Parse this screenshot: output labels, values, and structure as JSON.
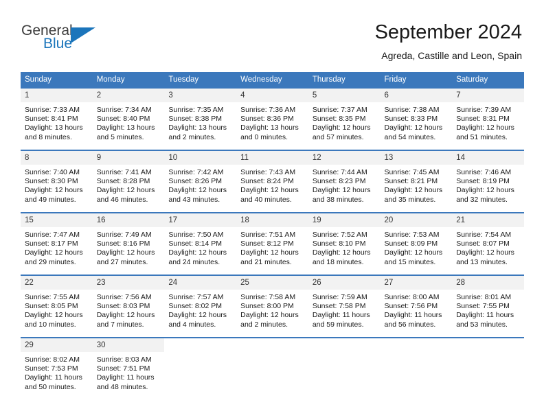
{
  "brand": {
    "line1": "General",
    "line2": "Blue",
    "accent_color": "#1b75bb"
  },
  "header": {
    "title": "September 2024",
    "subtitle": "Agreda, Castille and Leon, Spain"
  },
  "theme": {
    "header_blue": "#3b78bc",
    "daynum_bg": "#f2f2f2",
    "text": "#1a1a1a"
  },
  "weekdays": [
    "Sunday",
    "Monday",
    "Tuesday",
    "Wednesday",
    "Thursday",
    "Friday",
    "Saturday"
  ],
  "weeks": [
    [
      {
        "day": "1",
        "sunrise": "Sunrise: 7:33 AM",
        "sunset": "Sunset: 8:41 PM",
        "daylight1": "Daylight: 13 hours",
        "daylight2": "and 8 minutes."
      },
      {
        "day": "2",
        "sunrise": "Sunrise: 7:34 AM",
        "sunset": "Sunset: 8:40 PM",
        "daylight1": "Daylight: 13 hours",
        "daylight2": "and 5 minutes."
      },
      {
        "day": "3",
        "sunrise": "Sunrise: 7:35 AM",
        "sunset": "Sunset: 8:38 PM",
        "daylight1": "Daylight: 13 hours",
        "daylight2": "and 2 minutes."
      },
      {
        "day": "4",
        "sunrise": "Sunrise: 7:36 AM",
        "sunset": "Sunset: 8:36 PM",
        "daylight1": "Daylight: 13 hours",
        "daylight2": "and 0 minutes."
      },
      {
        "day": "5",
        "sunrise": "Sunrise: 7:37 AM",
        "sunset": "Sunset: 8:35 PM",
        "daylight1": "Daylight: 12 hours",
        "daylight2": "and 57 minutes."
      },
      {
        "day": "6",
        "sunrise": "Sunrise: 7:38 AM",
        "sunset": "Sunset: 8:33 PM",
        "daylight1": "Daylight: 12 hours",
        "daylight2": "and 54 minutes."
      },
      {
        "day": "7",
        "sunrise": "Sunrise: 7:39 AM",
        "sunset": "Sunset: 8:31 PM",
        "daylight1": "Daylight: 12 hours",
        "daylight2": "and 51 minutes."
      }
    ],
    [
      {
        "day": "8",
        "sunrise": "Sunrise: 7:40 AM",
        "sunset": "Sunset: 8:30 PM",
        "daylight1": "Daylight: 12 hours",
        "daylight2": "and 49 minutes."
      },
      {
        "day": "9",
        "sunrise": "Sunrise: 7:41 AM",
        "sunset": "Sunset: 8:28 PM",
        "daylight1": "Daylight: 12 hours",
        "daylight2": "and 46 minutes."
      },
      {
        "day": "10",
        "sunrise": "Sunrise: 7:42 AM",
        "sunset": "Sunset: 8:26 PM",
        "daylight1": "Daylight: 12 hours",
        "daylight2": "and 43 minutes."
      },
      {
        "day": "11",
        "sunrise": "Sunrise: 7:43 AM",
        "sunset": "Sunset: 8:24 PM",
        "daylight1": "Daylight: 12 hours",
        "daylight2": "and 40 minutes."
      },
      {
        "day": "12",
        "sunrise": "Sunrise: 7:44 AM",
        "sunset": "Sunset: 8:23 PM",
        "daylight1": "Daylight: 12 hours",
        "daylight2": "and 38 minutes."
      },
      {
        "day": "13",
        "sunrise": "Sunrise: 7:45 AM",
        "sunset": "Sunset: 8:21 PM",
        "daylight1": "Daylight: 12 hours",
        "daylight2": "and 35 minutes."
      },
      {
        "day": "14",
        "sunrise": "Sunrise: 7:46 AM",
        "sunset": "Sunset: 8:19 PM",
        "daylight1": "Daylight: 12 hours",
        "daylight2": "and 32 minutes."
      }
    ],
    [
      {
        "day": "15",
        "sunrise": "Sunrise: 7:47 AM",
        "sunset": "Sunset: 8:17 PM",
        "daylight1": "Daylight: 12 hours",
        "daylight2": "and 29 minutes."
      },
      {
        "day": "16",
        "sunrise": "Sunrise: 7:49 AM",
        "sunset": "Sunset: 8:16 PM",
        "daylight1": "Daylight: 12 hours",
        "daylight2": "and 27 minutes."
      },
      {
        "day": "17",
        "sunrise": "Sunrise: 7:50 AM",
        "sunset": "Sunset: 8:14 PM",
        "daylight1": "Daylight: 12 hours",
        "daylight2": "and 24 minutes."
      },
      {
        "day": "18",
        "sunrise": "Sunrise: 7:51 AM",
        "sunset": "Sunset: 8:12 PM",
        "daylight1": "Daylight: 12 hours",
        "daylight2": "and 21 minutes."
      },
      {
        "day": "19",
        "sunrise": "Sunrise: 7:52 AM",
        "sunset": "Sunset: 8:10 PM",
        "daylight1": "Daylight: 12 hours",
        "daylight2": "and 18 minutes."
      },
      {
        "day": "20",
        "sunrise": "Sunrise: 7:53 AM",
        "sunset": "Sunset: 8:09 PM",
        "daylight1": "Daylight: 12 hours",
        "daylight2": "and 15 minutes."
      },
      {
        "day": "21",
        "sunrise": "Sunrise: 7:54 AM",
        "sunset": "Sunset: 8:07 PM",
        "daylight1": "Daylight: 12 hours",
        "daylight2": "and 13 minutes."
      }
    ],
    [
      {
        "day": "22",
        "sunrise": "Sunrise: 7:55 AM",
        "sunset": "Sunset: 8:05 PM",
        "daylight1": "Daylight: 12 hours",
        "daylight2": "and 10 minutes."
      },
      {
        "day": "23",
        "sunrise": "Sunrise: 7:56 AM",
        "sunset": "Sunset: 8:03 PM",
        "daylight1": "Daylight: 12 hours",
        "daylight2": "and 7 minutes."
      },
      {
        "day": "24",
        "sunrise": "Sunrise: 7:57 AM",
        "sunset": "Sunset: 8:02 PM",
        "daylight1": "Daylight: 12 hours",
        "daylight2": "and 4 minutes."
      },
      {
        "day": "25",
        "sunrise": "Sunrise: 7:58 AM",
        "sunset": "Sunset: 8:00 PM",
        "daylight1": "Daylight: 12 hours",
        "daylight2": "and 2 minutes."
      },
      {
        "day": "26",
        "sunrise": "Sunrise: 7:59 AM",
        "sunset": "Sunset: 7:58 PM",
        "daylight1": "Daylight: 11 hours",
        "daylight2": "and 59 minutes."
      },
      {
        "day": "27",
        "sunrise": "Sunrise: 8:00 AM",
        "sunset": "Sunset: 7:56 PM",
        "daylight1": "Daylight: 11 hours",
        "daylight2": "and 56 minutes."
      },
      {
        "day": "28",
        "sunrise": "Sunrise: 8:01 AM",
        "sunset": "Sunset: 7:55 PM",
        "daylight1": "Daylight: 11 hours",
        "daylight2": "and 53 minutes."
      }
    ],
    [
      {
        "day": "29",
        "sunrise": "Sunrise: 8:02 AM",
        "sunset": "Sunset: 7:53 PM",
        "daylight1": "Daylight: 11 hours",
        "daylight2": "and 50 minutes."
      },
      {
        "day": "30",
        "sunrise": "Sunrise: 8:03 AM",
        "sunset": "Sunset: 7:51 PM",
        "daylight1": "Daylight: 11 hours",
        "daylight2": "and 48 minutes."
      },
      {
        "day": "",
        "sunrise": "",
        "sunset": "",
        "daylight1": "",
        "daylight2": ""
      },
      {
        "day": "",
        "sunrise": "",
        "sunset": "",
        "daylight1": "",
        "daylight2": ""
      },
      {
        "day": "",
        "sunrise": "",
        "sunset": "",
        "daylight1": "",
        "daylight2": ""
      },
      {
        "day": "",
        "sunrise": "",
        "sunset": "",
        "daylight1": "",
        "daylight2": ""
      },
      {
        "day": "",
        "sunrise": "",
        "sunset": "",
        "daylight1": "",
        "daylight2": ""
      }
    ]
  ]
}
